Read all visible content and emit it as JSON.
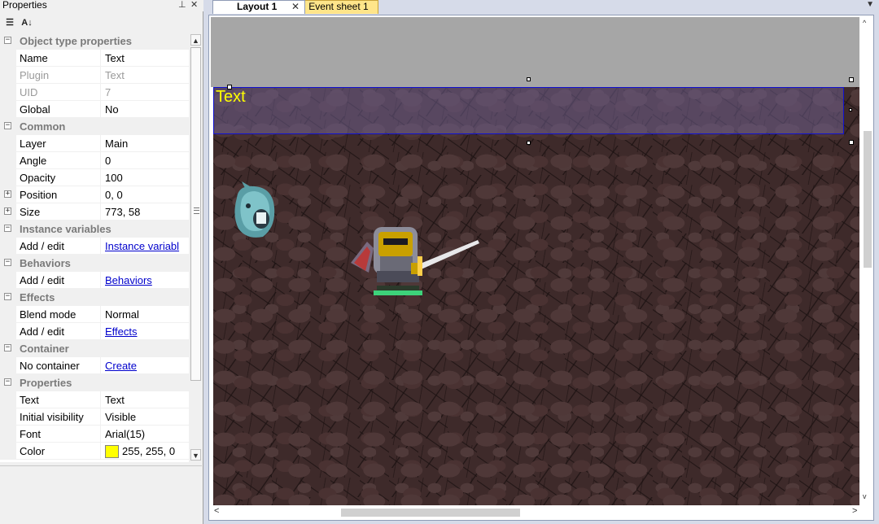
{
  "properties_panel": {
    "title": "Properties",
    "pin_icon": "pin-icon",
    "close_glyph": "✕",
    "toolbar": {
      "categorized_icon": "categorized-icon",
      "sort_az_icon": "sort-az-icon"
    }
  },
  "rows": [
    {
      "type": "cat",
      "label": "Object type properties"
    },
    {
      "type": "prop",
      "name": "Name",
      "value": "Text"
    },
    {
      "type": "prop",
      "name": "Plugin",
      "value": "Text",
      "dim": true
    },
    {
      "type": "prop",
      "name": "UID",
      "value": "7",
      "dim": true
    },
    {
      "type": "prop",
      "name": "Global",
      "value": "No"
    },
    {
      "type": "cat",
      "label": "Common"
    },
    {
      "type": "prop",
      "name": "Layer",
      "value": "Main"
    },
    {
      "type": "prop",
      "name": "Angle",
      "value": "0"
    },
    {
      "type": "prop",
      "name": "Opacity",
      "value": "100"
    },
    {
      "type": "prop",
      "name": "Position",
      "value": "0, 0",
      "expand": true
    },
    {
      "type": "prop",
      "name": "Size",
      "value": "773, 58",
      "expand": true
    },
    {
      "type": "cat",
      "label": "Instance variables"
    },
    {
      "type": "prop",
      "name": "Add / edit",
      "value": "Instance variabl",
      "link": true
    },
    {
      "type": "cat",
      "label": "Behaviors"
    },
    {
      "type": "prop",
      "name": "Add / edit",
      "value": "Behaviors",
      "link": true
    },
    {
      "type": "cat",
      "label": "Effects"
    },
    {
      "type": "prop",
      "name": "Blend mode",
      "value": "Normal"
    },
    {
      "type": "prop",
      "name": "Add / edit",
      "value": "Effects",
      "link": true
    },
    {
      "type": "cat",
      "label": "Container"
    },
    {
      "type": "prop",
      "name": "No container",
      "value": "Create",
      "link": true
    },
    {
      "type": "cat",
      "label": "Properties"
    },
    {
      "type": "prop",
      "name": "Text",
      "value": "Text"
    },
    {
      "type": "prop",
      "name": "Initial visibility",
      "value": "Visible"
    },
    {
      "type": "prop",
      "name": "Font",
      "value": "Arial(15)"
    },
    {
      "type": "prop",
      "name": "Color",
      "value": "255, 255, 0",
      "swatch": "#ffff00"
    }
  ],
  "tabs": {
    "layout_label": "Layout 1",
    "events_label": "Event sheet 1",
    "close_glyph": "✕",
    "menu_glyph": "▼"
  },
  "layout": {
    "text_object_label": "Text",
    "text_color": "#ffff00",
    "selection_color": "#1010d0"
  },
  "scroll_arrows": {
    "up": "▲",
    "down": "▼",
    "left": "<",
    "right": ">",
    "v_up": "^",
    "v_down": "v"
  }
}
